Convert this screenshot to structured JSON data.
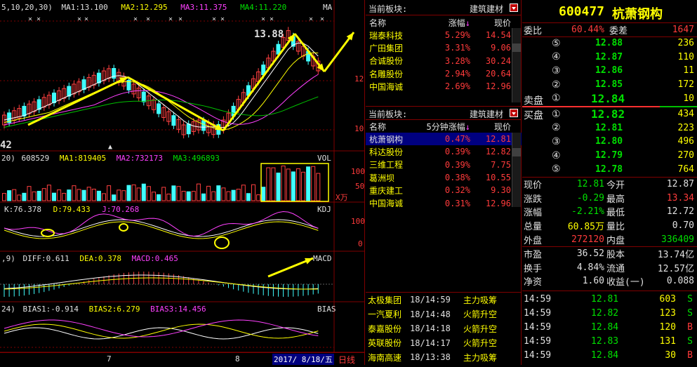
{
  "left": {
    "ma_header": {
      "label": "5,10,20,30)",
      "ma1": "MA1:13.100",
      "ma2": "MA2:12.295",
      "ma3": "MA3:11.375",
      "ma4": "MA4:11.220",
      "tag": "MA"
    },
    "price_labels": {
      "high": "13.88",
      "low": "42",
      "y12": "12",
      "y10": "10"
    },
    "vol_header": {
      "label": "20)",
      "v": "608529",
      "ma1": "MA1:819405",
      "ma2": "MA2:732173",
      "ma3": "MA3:496893",
      "tag": "VOL"
    },
    "vol_axis": {
      "top": "100",
      "mid": "50",
      "unit": "X万"
    },
    "kdj_header": {
      "k": "K:76.378",
      "d": "D:79.433",
      "j": "J:70.268",
      "tag": "KDJ"
    },
    "kdj_axis": {
      "top": "100",
      "bottom": "0"
    },
    "macd_header": {
      "label": ",9)",
      "diff": "DIFF:0.611",
      "dea": "DEA:0.378",
      "macd": "MACD:0.465",
      "tag": "MACD"
    },
    "bias_header": {
      "label": "24)",
      "b1": "BIAS1:-0.914",
      "b2": "BIAS2:6.279",
      "b3": "BIAS3:14.456",
      "tag": "BIAS"
    },
    "bottom": {
      "m7": "7",
      "m8": "8",
      "date": "2017/ 8/18/五",
      "daily": "日线"
    }
  },
  "board1": {
    "title": "当前板块:",
    "sector": "建筑建材",
    "headers": [
      "名称",
      "涨幅",
      "现价"
    ],
    "rows": [
      {
        "name": "瑞泰科技",
        "pct": "5.29%",
        "price": "14.54"
      },
      {
        "name": "广田集团",
        "pct": "3.31%",
        "price": "9.06"
      },
      {
        "name": "合诚股份",
        "pct": "3.28%",
        "price": "30.24"
      },
      {
        "name": "名雕股份",
        "pct": "2.94%",
        "price": "20.64"
      },
      {
        "name": "中国海诚",
        "pct": "2.69%",
        "price": "12.96"
      }
    ]
  },
  "board2": {
    "title": "当前板块:",
    "sector": "建筑建材",
    "headers": [
      "名称",
      "5分钟涨幅",
      "现价"
    ],
    "rows": [
      {
        "name": "杭萧钢构",
        "pct": "0.47%",
        "price": "12.81"
      },
      {
        "name": "科达股份",
        "pct": "0.39%",
        "price": "12.82"
      },
      {
        "name": "三维工程",
        "pct": "0.39%",
        "price": "7.75"
      },
      {
        "name": "葛洲坝",
        "pct": "0.38%",
        "price": "10.55"
      },
      {
        "name": "重庆建工",
        "pct": "0.32%",
        "price": "9.30"
      },
      {
        "name": "中国海诚",
        "pct": "0.31%",
        "price": "12.96"
      }
    ]
  },
  "alerts": [
    {
      "name": "太极集团",
      "time": "18/14:59",
      "msg": "主力吸筹"
    },
    {
      "name": "一汽夏利",
      "time": "18/14:48",
      "msg": "火箭升空"
    },
    {
      "name": "泰嘉股份",
      "time": "18/14:18",
      "msg": "火箭升空"
    },
    {
      "name": "英联股份",
      "time": "18/14:17",
      "msg": "火箭升空"
    },
    {
      "name": "海南高速",
      "time": "18/13:38",
      "msg": "主力吸筹"
    }
  ],
  "quote": {
    "code": "600477",
    "name": "杭萧钢构",
    "wb_label": "委比",
    "wb": "60.44%",
    "wc_label": "委差",
    "wc": "1647",
    "sell": [
      {
        "n": "⑤",
        "p": "12.88",
        "v": "236"
      },
      {
        "n": "④",
        "p": "12.87",
        "v": "110"
      },
      {
        "n": "③",
        "p": "12.86",
        "v": "11"
      },
      {
        "n": "②",
        "p": "12.85",
        "v": "172"
      },
      {
        "n": "①",
        "p": "12.84",
        "v": "10"
      }
    ],
    "sell_label": "卖盘",
    "buy_label": "买盘",
    "buy": [
      {
        "n": "①",
        "p": "12.82",
        "v": "434"
      },
      {
        "n": "②",
        "p": "12.81",
        "v": "223"
      },
      {
        "n": "③",
        "p": "12.80",
        "v": "496"
      },
      {
        "n": "④",
        "p": "12.79",
        "v": "270"
      },
      {
        "n": "⑤",
        "p": "12.78",
        "v": "764"
      }
    ],
    "stats": [
      {
        "l1": "现价",
        "v1": "12.81",
        "l2": "今开",
        "v2": "12.87"
      },
      {
        "l1": "涨跌",
        "v1": "-0.29",
        "l2": "最高",
        "v2": "13.34"
      },
      {
        "l1": "涨幅",
        "v1": "-2.21%",
        "l2": "最低",
        "v2": "12.72"
      },
      {
        "l1": "总量",
        "v1": "60.85万",
        "l2": "量比",
        "v2": "0.70"
      },
      {
        "l1": "外盘",
        "v1": "272120",
        "l2": "内盘",
        "v2": "336409"
      }
    ],
    "stats2": [
      {
        "l1": "市盈",
        "v1": "36.52",
        "l2": "股本",
        "v2": "13.74亿"
      },
      {
        "l1": "换手",
        "v1": "4.84%",
        "l2": "流通",
        "v2": "12.57亿"
      },
      {
        "l1": "净资",
        "v1": "1.60",
        "l2": "收益(一)",
        "v2": "0.088"
      }
    ],
    "ticks": [
      {
        "t": "14:59",
        "p": "12.81",
        "v": "603",
        "s": "S"
      },
      {
        "t": "14:59",
        "p": "12.82",
        "v": "123",
        "s": "S"
      },
      {
        "t": "14:59",
        "p": "12.84",
        "v": "120",
        "s": "B"
      },
      {
        "t": "14:59",
        "p": "12.83",
        "v": "131",
        "s": "S"
      },
      {
        "t": "14:59",
        "p": "12.84",
        "v": "30",
        "s": "B"
      }
    ]
  }
}
